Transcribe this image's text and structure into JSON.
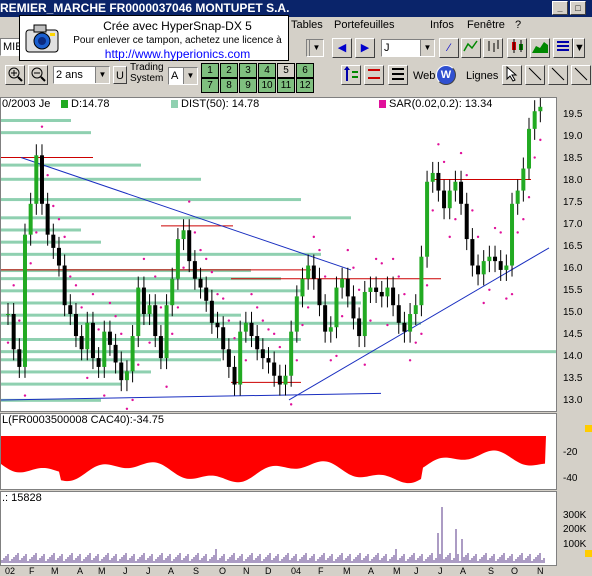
{
  "title": "REMIER_MARCHE    FR0000037046  MONTUPET S.A.",
  "window_buttons": [
    "_",
    "□"
  ],
  "menu": [
    "Tables",
    "Portefeuilles",
    "Infos",
    "Fenêtre",
    "?"
  ],
  "hypersnap": {
    "line1": "Crée avec HyperSnap-DX 5",
    "line2": "Pour enlever ce tampon, achetez une licence à",
    "line3": "http://www.hyperionics.com"
  },
  "toolbar": {
    "market_value": "MIE",
    "period_value": "J",
    "range_value": "2 ans",
    "u_label": "U",
    "trading_system_label": "Trading System",
    "ts_value": "A",
    "number_buttons": [
      "1",
      "2",
      "3",
      "4",
      "5",
      "6",
      "7",
      "8",
      "9",
      "10",
      "11",
      "12"
    ],
    "web_label": "Web",
    "lignes_label": "Lignes"
  },
  "main_legend": {
    "date": "0/2003 Je",
    "d_label": "D:14.78",
    "dist_label": "DIST(50): 14.78",
    "sar_label": "SAR(0.02,0.2): 13.34"
  },
  "colors": {
    "price_up": "#22aa22",
    "price_down": "#000000",
    "sar": "#e0109a",
    "trend": "#1a2fc0",
    "volume_profile": "#8fd0b0",
    "resistance": "#cc0000",
    "macd": "#ff0000",
    "volume": "#5a3a8a"
  },
  "price_axis": [
    "19.5",
    "19.0",
    "18.5",
    "18.0",
    "17.5",
    "17.0",
    "16.5",
    "16.0",
    "15.5",
    "15.0",
    "14.5",
    "14.0",
    "13.5",
    "13.0"
  ],
  "indicator_pane": {
    "label": "L(FR0003500008   CAC40):-34.75",
    "ticks": [
      "-20",
      "-40"
    ]
  },
  "volume_pane": {
    "label": ".: 15828",
    "ticks": [
      "300K",
      "200K",
      "100K"
    ]
  },
  "x_labels": [
    "02",
    "F",
    "M",
    "A",
    "M",
    "J",
    "J",
    "A",
    "S",
    "O",
    "N",
    "D",
    "04",
    "F",
    "M",
    "A",
    "M",
    "J",
    "J",
    "A",
    "S",
    "O",
    "N"
  ],
  "chart_data": {
    "type": "line",
    "title": "",
    "y_range": [
      12.8,
      19.9
    ],
    "price_ticks": [
      19.5,
      19.0,
      18.5,
      18.0,
      17.5,
      17.0,
      16.5,
      16.0,
      15.5,
      15.0,
      14.5,
      14.0,
      13.5,
      13.0
    ],
    "close_series": [
      15.0,
      14.2,
      13.8,
      16.8,
      17.5,
      18.6,
      17.5,
      16.8,
      16.5,
      16.1,
      15.2,
      15.0,
      14.5,
      14.2,
      14.8,
      14.0,
      13.8,
      14.6,
      14.3,
      13.9,
      13.5,
      13.7,
      14.5,
      15.6,
      15.0,
      15.2,
      14.5,
      14.0,
      15.2,
      15.8,
      16.7,
      16.9,
      16.2,
      15.8,
      15.6,
      15.3,
      14.8,
      14.7,
      14.2,
      13.8,
      13.4,
      14.6,
      14.8,
      14.5,
      14.2,
      14.0,
      13.9,
      13.6,
      13.4,
      13.6,
      14.6,
      15.4,
      15.8,
      16.1,
      15.8,
      15.2,
      14.6,
      14.7,
      15.6,
      15.8,
      15.4,
      14.9,
      14.5,
      15.5,
      15.6,
      15.5,
      15.4,
      15.6,
      15.2,
      14.8,
      14.6,
      15.0,
      15.2,
      16.3,
      18.0,
      18.2,
      17.8,
      17.4,
      17.8,
      18.0,
      17.5,
      16.7,
      16.1,
      15.9,
      16.2,
      16.3,
      16.2,
      16.0,
      16.1,
      17.5,
      17.8,
      18.3,
      19.2,
      19.6,
      19.7
    ],
    "volume_ticks": [
      "300K",
      "200K",
      "100K"
    ],
    "indicator_ticks": [
      -20,
      -40
    ]
  }
}
